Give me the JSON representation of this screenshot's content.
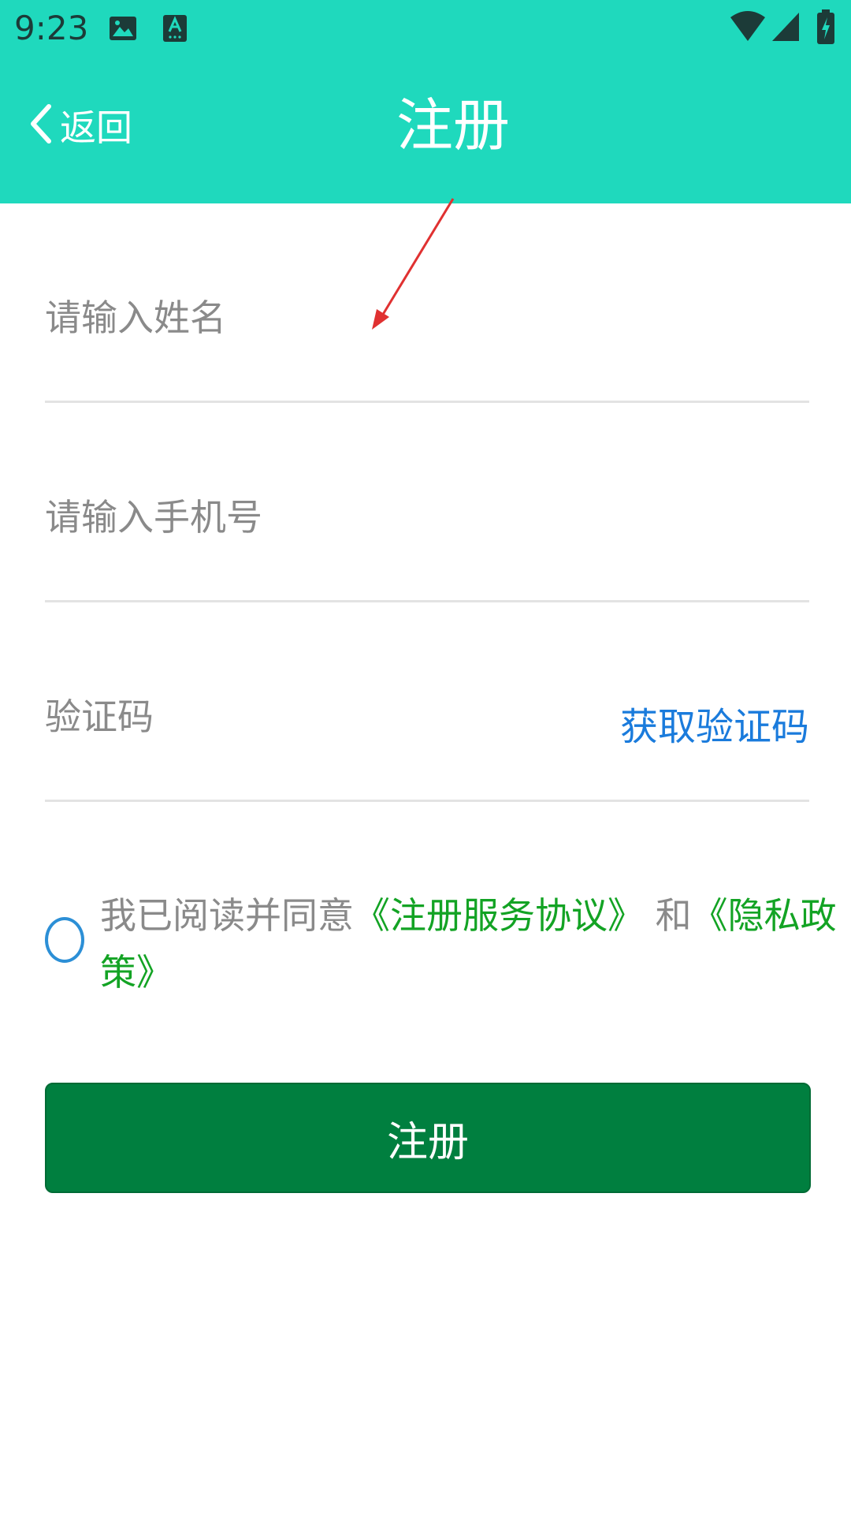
{
  "status_bar": {
    "time": "9:23"
  },
  "header": {
    "back_label": "返回",
    "title": "注册"
  },
  "form": {
    "name_placeholder": "请输入姓名",
    "phone_placeholder": "请输入手机号",
    "code_placeholder": "验证码",
    "get_code_label": "获取验证码"
  },
  "agreement": {
    "prefix": "我已阅读并同意",
    "service_link": "《注册服务协议》",
    "connector": " 和",
    "privacy_link": "《隐私政策》"
  },
  "register_button": {
    "label": "注册"
  },
  "colors": {
    "header_bg": "#1fd9bd",
    "button_bg": "#007f3f",
    "link_green": "#13a324",
    "link_blue": "#1a7bdc",
    "annotation_red": "#e03131"
  }
}
